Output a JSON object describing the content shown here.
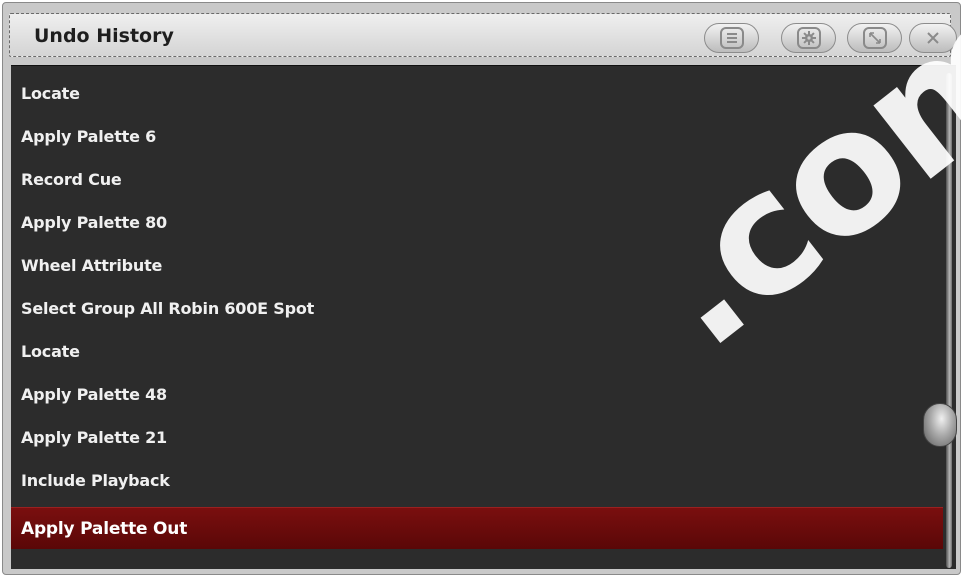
{
  "window": {
    "title": "Undo History",
    "buttons": [
      {
        "name": "menu-button",
        "icon": "list-icon"
      },
      {
        "name": "settings-button",
        "icon": "gear-icon"
      },
      {
        "name": "resize-button",
        "icon": "resize-icon"
      },
      {
        "name": "close-button",
        "icon": "close-icon"
      }
    ]
  },
  "history": {
    "items": [
      "Locate",
      "Apply Palette  6",
      "Record Cue",
      "Apply Palette  80",
      "Wheel Attribute",
      "Select Group All Robin 600E Spot",
      "Locate",
      "Apply Palette  48",
      "Apply Palette  21",
      "Include Playback",
      "Apply Palette Out"
    ],
    "selected_index": 10
  },
  "watermark": {
    "text": ".com"
  },
  "colors": {
    "list_background": "#2c2c2c",
    "selected_row": "#6e0b0b",
    "titlebar": "#d9d9d9"
  }
}
